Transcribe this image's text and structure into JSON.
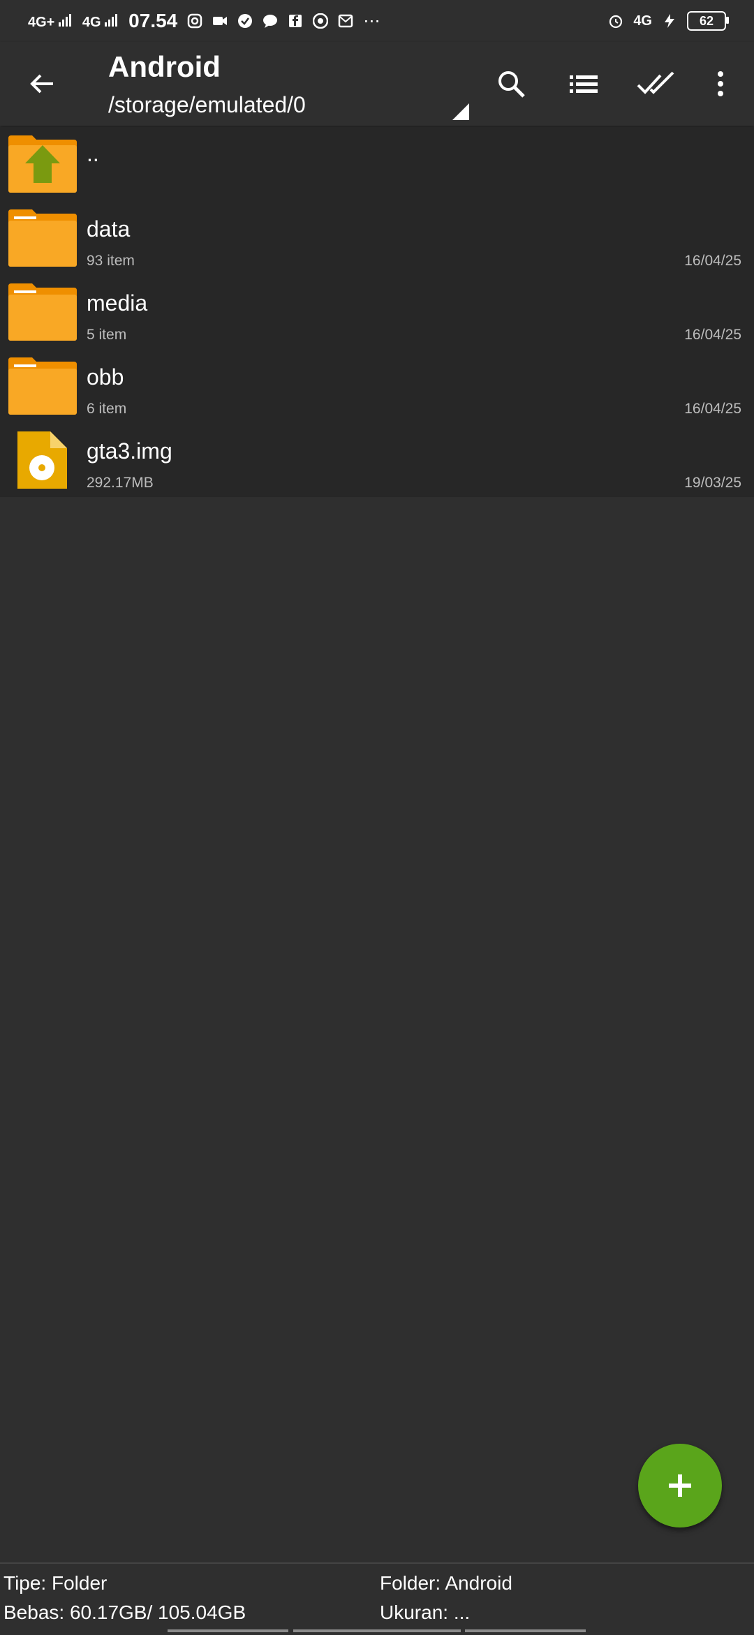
{
  "status_bar": {
    "signal1": "4G+",
    "signal2": "4G",
    "time": "07.54",
    "network_right": "4G",
    "battery": "62"
  },
  "app_bar": {
    "title": "Android",
    "path": "/storage/emulated/0"
  },
  "files": [
    {
      "name": "..",
      "meta": "",
      "date": "",
      "icon": "folder-up-icon"
    },
    {
      "name": "data",
      "meta": "93 item",
      "date": "16/04/25",
      "icon": "folder-icon"
    },
    {
      "name": "media",
      "meta": "5 item",
      "date": "16/04/25",
      "icon": "folder-icon"
    },
    {
      "name": "obb",
      "meta": "6 item",
      "date": "16/04/25",
      "icon": "folder-icon"
    },
    {
      "name": "gta3.img",
      "meta": "292.17MB",
      "date": "19/03/25",
      "icon": "disc-image-icon"
    }
  ],
  "footer": {
    "type": "Tipe: Folder",
    "free": "Bebas: 60.17GB/ 105.04GB",
    "folder": "Folder: Android",
    "size": "Ukuran: ..."
  },
  "colors": {
    "background": "#2f2f2f",
    "list_background": "#272727",
    "folder_orange": "#f9a825",
    "fab_green": "#5aa51b"
  }
}
